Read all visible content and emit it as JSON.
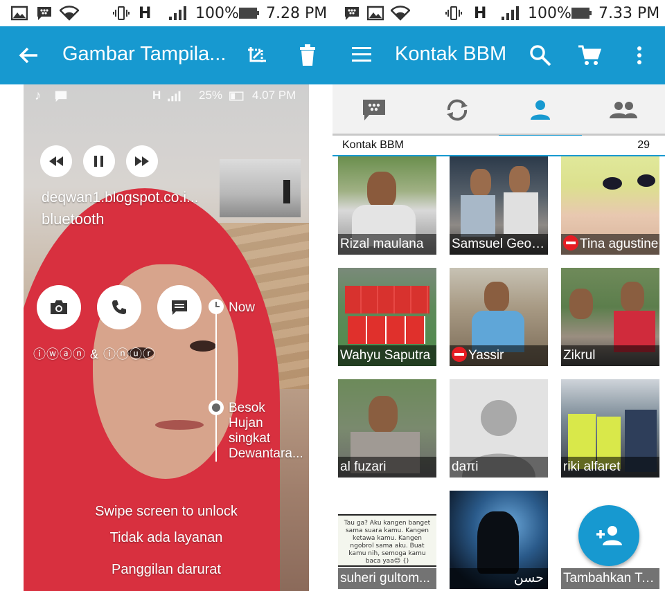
{
  "left": {
    "status": {
      "battery": "100%",
      "time": "7.28 PM",
      "network": "H"
    },
    "appbar": {
      "title": "Gambar Tampila..."
    },
    "lockscreen": {
      "status": {
        "battery": "25%",
        "time": "4.07 PM",
        "network": "H"
      },
      "media_title": "deqwan1.blogspot.co.i...",
      "media_subtitle": "bluetooth",
      "owner_text": "ⓘⓦⓐⓝ & ⓘⓝⓤⓡ",
      "now_label": "Now",
      "event_title": "Besok",
      "event_lines": [
        "Hujan",
        "singkat",
        "Dewantara..."
      ],
      "swipe_text": "Swipe screen to unlock",
      "no_service": "Tidak ada layanan",
      "emergency": "Panggilan darurat"
    }
  },
  "right": {
    "status": {
      "battery": "100%",
      "time": "7.33 PM",
      "network": "H"
    },
    "appbar": {
      "title": "Kontak BBM"
    },
    "list_header": {
      "label": "Kontak BBM",
      "count": "29"
    },
    "contacts": [
      {
        "name": "Rizal maulana"
      },
      {
        "name": "Samsuel Geouni..."
      },
      {
        "name": "Tina agustine"
      },
      {
        "name": "Wahyu Saputra"
      },
      {
        "name": "Yassir"
      },
      {
        "name": "Zikrul"
      },
      {
        "name": "al fuzari"
      },
      {
        "name": "daπi"
      },
      {
        "name": "riki alfaret"
      },
      {
        "name": "suheri gultom..."
      },
      {
        "name": "حسن"
      },
      {
        "name": "Tambahkan Te..."
      }
    ],
    "quote_card": {
      "text": "Tau ga? Aku kangen banget sama suara kamu. Kangen ketawa kamu. Kangen ngobrol sama aku. Buat kamu nih, semoga kamu baca yaa😊 {)"
    }
  },
  "colors": {
    "accent": "#1799d0",
    "red": "#e51c23"
  }
}
